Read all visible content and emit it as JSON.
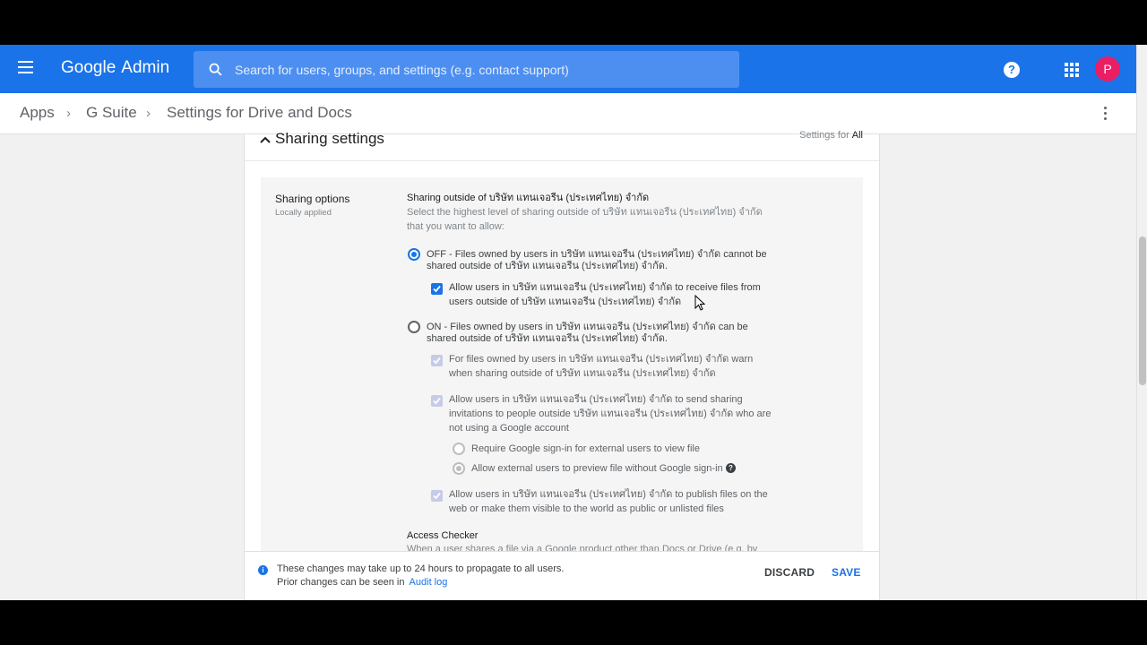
{
  "header": {
    "brand_google": "Google",
    "brand_admin": "Admin",
    "search_placeholder": "Search for users, groups, and settings (e.g. contact support)",
    "help_icon": "?",
    "avatar_initial": "P",
    "accent_color": "#1a73e8"
  },
  "breadcrumb": {
    "items": [
      "Apps",
      "G Suite",
      "Settings for Drive and Docs"
    ],
    "separator": "›"
  },
  "card": {
    "title": "Sharing settings",
    "settings_for_label": "Settings for",
    "settings_for_value": "All"
  },
  "sharing_options": {
    "label": "Sharing options",
    "sublabel": "Locally applied",
    "heading": "Sharing outside of บริษัท แทนเจอรีน (ประเทศไทย) จำกัด",
    "description_line1": "Select the highest level of sharing outside of บริษัท แทนเจอรีน (ประเทศไทย) จำกัด",
    "description_line2": "that you want to allow:",
    "off_option": {
      "line1": "OFF - Files owned by users in บริษัท แทนเจอรีน (ประเทศไทย) จำกัด cannot be",
      "line2": "shared outside of บริษัท แทนเจอรีน (ประเทศไทย) จำกัด.",
      "selected": true
    },
    "allow_receive": {
      "line1": "Allow users in บริษัท แทนเจอรีน (ประเทศไทย) จำกัด to receive files from",
      "line2": "users outside of บริษัท แทนเจอรีน (ประเทศไทย) จำกัด",
      "checked": true
    },
    "on_option": {
      "line1": "ON - Files owned by users in บริษัท แทนเจอรีน (ประเทศไทย) จำกัด can be",
      "line2": "shared outside of บริษัท แทนเจอรีน (ประเทศไทย) จำกัด.",
      "selected": false
    },
    "warn_option": {
      "line1": "For files owned by users in บริษัท แทนเจอรีน (ประเทศไทย) จำกัด warn",
      "line2": "when sharing outside of บริษัท แทนเจอรีน (ประเทศไทย) จำกัด"
    },
    "invite_option": {
      "line1": "Allow users in บริษัท แทนเจอรีน (ประเทศไทย) จำกัด to send sharing",
      "line2": "invitations to people outside บริษัท แทนเจอรีน (ประเทศไทย) จำกัด who are",
      "line3": "not using a Google account"
    },
    "require_signin": "Require Google sign-in for external users to view file",
    "allow_preview": "Allow external users to preview file without Google sign-in",
    "publish_option": {
      "line1": "Allow users in บริษัท แทนเจอรีน (ประเทศไทย) จำกัด to publish files on the",
      "line2": "web or make them visible to the world as public or unlisted files"
    },
    "access_checker_title": "Access Checker",
    "access_checker_desc": "When a user shares a file via a Google product other than Docs or Drive (e.g. by"
  },
  "footer": {
    "info_icon": "i",
    "line1": "These changes may take up to 24 hours to propagate to all users.",
    "line2": "Prior changes can be seen in",
    "audit_link": "Audit log",
    "discard_label": "DISCARD",
    "save_label": "SAVE"
  }
}
